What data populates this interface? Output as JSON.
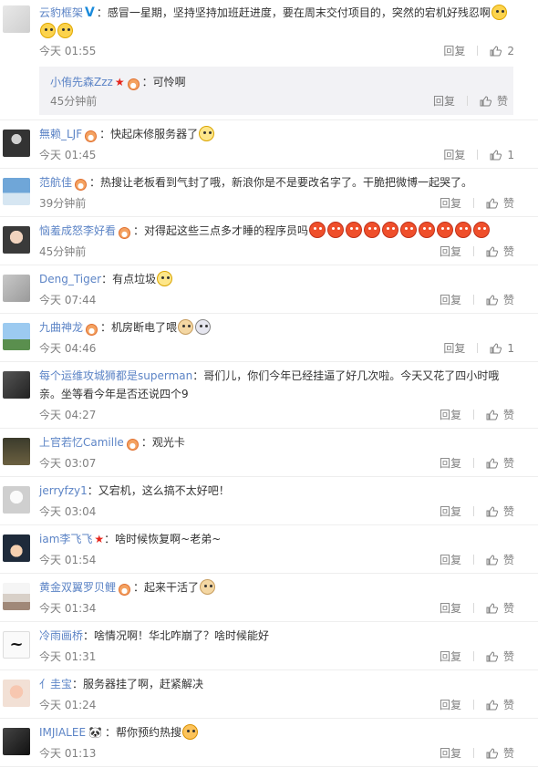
{
  "actions": {
    "reply": "回复",
    "like": "赞"
  },
  "comments": [
    {
      "name": "云豹框架",
      "text": "感冒一星期，坚持坚持加班赶进度，要在周末交付项目的，突然的宕机好残忍啊",
      "time": "今天 01:55",
      "like": "2",
      "sub": {
        "name": "小侑先森Zzz",
        "text": "可怜啊",
        "time": "45分钟前",
        "like": "赞"
      }
    },
    {
      "name": "無赖_LJF",
      "text": "快起床修服务器了",
      "time": "今天 01:45",
      "like": "1"
    },
    {
      "name": "范航佳",
      "text": "热搜让老板看到气封了哦，新浪你是不是要改名字了。干脆把微博一起哭了。",
      "time": "39分钟前",
      "like": "赞"
    },
    {
      "name": "恼羞成怒李好看",
      "text": "对得起这些三点多才睡的程序员吗",
      "time": "45分钟前",
      "like": "赞"
    },
    {
      "name": "Deng_Tiger",
      "text": "有点垃圾",
      "time": "今天 07:44",
      "like": "赞"
    },
    {
      "name": "九曲神龙",
      "text": "机房断电了喂",
      "time": "今天 04:46",
      "like": "1"
    },
    {
      "name": "每个运维攻城狮都是superman",
      "text": "哥们儿，你们今年已经挂逼了好几次啦。今天又花了四小时哦亲。坐等看今年是否还说四个9",
      "time": "今天 04:27",
      "like": "赞"
    },
    {
      "name": "上官若忆Camille",
      "text": "观光卡",
      "time": "今天 03:07",
      "like": "赞"
    },
    {
      "name": "jerryfzy1",
      "text": "又宕机，这么搞不太好吧！",
      "time": "今天 03:04",
      "like": "赞"
    },
    {
      "name": "iam李飞飞",
      "text": "啥时候恢复啊~老弟~",
      "time": "今天 01:54",
      "like": "赞"
    },
    {
      "name": "黄金双翼罗贝鲤",
      "text": "起来干活了",
      "time": "今天 01:34",
      "like": "赞"
    },
    {
      "name": "冷雨画桥",
      "text": "啥情况啊！华北咋崩了？啥时候能好",
      "time": "今天 01:31",
      "like": "赞"
    },
    {
      "name": "亻圭宝",
      "text": "服务器挂了啊，赶紧解决",
      "time": "今天 01:24",
      "like": "赞"
    },
    {
      "name": "IMJIALEE",
      "text": "帮你预约热搜",
      "time": "今天 01:13",
      "like": "赞"
    }
  ]
}
